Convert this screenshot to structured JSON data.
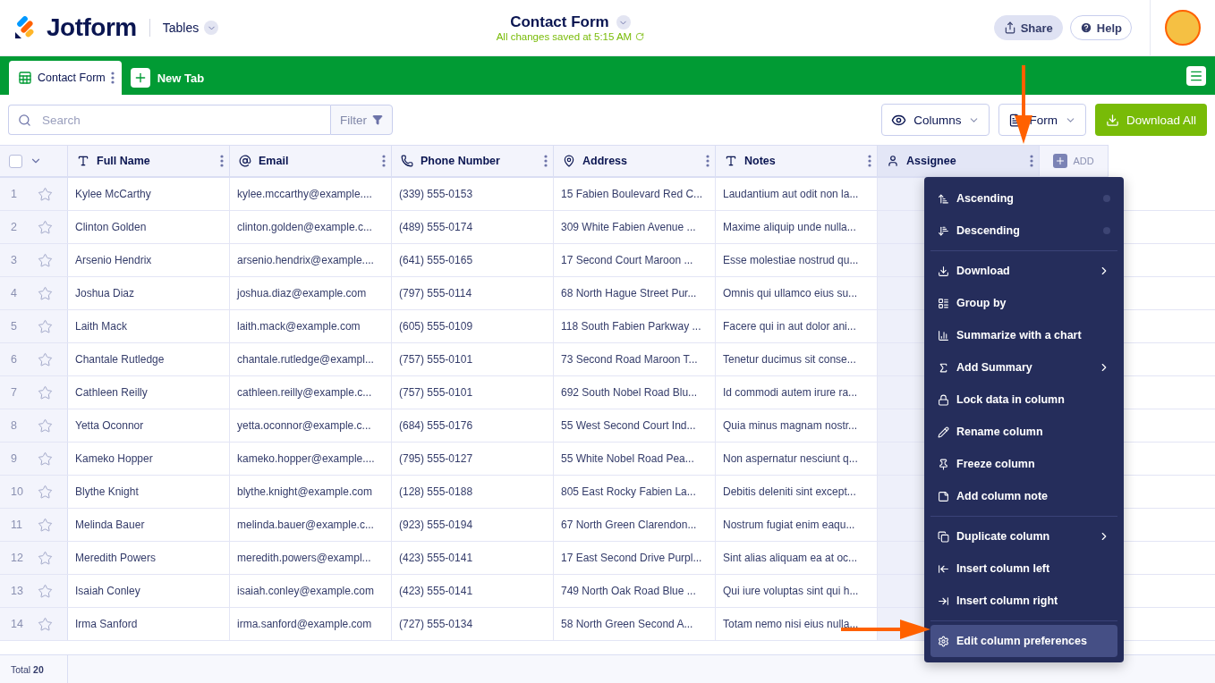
{
  "header": {
    "logo": "Jotform",
    "nav": "Tables",
    "title": "Contact Form",
    "save_status": "All changes saved at 5:15 AM",
    "share": "Share",
    "help": "Help"
  },
  "tabs": [
    {
      "label": "Contact Form",
      "selected": true
    }
  ],
  "new_tab": "New Tab",
  "toolbar": {
    "search_placeholder": "Search",
    "filter": "Filter",
    "columns": "Columns",
    "form": "Form",
    "download": "Download All"
  },
  "table": {
    "select_all": {
      "checked": false
    },
    "columns": [
      {
        "label": "Full Name",
        "kind": "text",
        "selected": false
      },
      {
        "label": "Email",
        "kind": "email",
        "selected": false
      },
      {
        "label": "Phone Number",
        "kind": "phone",
        "selected": false
      },
      {
        "label": "Address",
        "kind": "address",
        "selected": false
      },
      {
        "label": "Notes",
        "kind": "notes",
        "selected": false
      },
      {
        "label": "Assignee",
        "kind": "person",
        "selected": true
      }
    ],
    "add_column": "ADD",
    "rows": [
      {
        "number": "1",
        "starred": false,
        "cells": [
          "Kylee McCarthy",
          "kylee.mccarthy@example....",
          "(339) 555-0153",
          "15 Fabien Boulevard Red C...",
          "Laudantium aut odit non la...",
          ""
        ]
      },
      {
        "number": "2",
        "starred": false,
        "cells": [
          "Clinton Golden",
          "clinton.golden@example.c...",
          "(489) 555-0174",
          "309 White Fabien Avenue ...",
          "Maxime aliquip unde nulla...",
          ""
        ]
      },
      {
        "number": "3",
        "starred": false,
        "cells": [
          "Arsenio Hendrix",
          "arsenio.hendrix@example....",
          "(641) 555-0165",
          "17 Second Court Maroon ...",
          "Esse molestiae nostrud qu...",
          ""
        ]
      },
      {
        "number": "4",
        "starred": false,
        "cells": [
          "Joshua Diaz",
          "joshua.diaz@example.com",
          "(797) 555-0114",
          "68 North Hague Street Pur...",
          "Omnis qui ullamco eius su...",
          ""
        ]
      },
      {
        "number": "5",
        "starred": false,
        "cells": [
          "Laith Mack",
          "laith.mack@example.com",
          "(605) 555-0109",
          "118 South Fabien Parkway ...",
          "Facere qui in aut dolor ani...",
          ""
        ]
      },
      {
        "number": "6",
        "starred": false,
        "cells": [
          "Chantale Rutledge",
          "chantale.rutledge@exampl...",
          "(757) 555-0101",
          "73 Second Road Maroon T...",
          "Tenetur ducimus sit conse...",
          ""
        ]
      },
      {
        "number": "7",
        "starred": false,
        "cells": [
          "Cathleen Reilly",
          "cathleen.reilly@example.c...",
          "(757) 555-0101",
          "692 South Nobel Road Blu...",
          "Id commodi autem irure ra...",
          ""
        ]
      },
      {
        "number": "8",
        "starred": false,
        "cells": [
          "Yetta Oconnor",
          "yetta.oconnor@example.c...",
          "(684) 555-0176",
          "55 West Second Court Ind...",
          "Quia minus magnam nostr...",
          ""
        ]
      },
      {
        "number": "9",
        "starred": false,
        "cells": [
          "Kameko Hopper",
          "kameko.hopper@example....",
          "(795) 555-0127",
          "55 White Nobel Road Pea...",
          "Non aspernatur nesciunt q...",
          ""
        ]
      },
      {
        "number": "10",
        "starred": false,
        "cells": [
          "Blythe Knight",
          "blythe.knight@example.com",
          "(128) 555-0188",
          "805 East Rocky Fabien La...",
          "Debitis deleniti sint except...",
          ""
        ]
      },
      {
        "number": "11",
        "starred": false,
        "cells": [
          "Melinda Bauer",
          "melinda.bauer@example.c...",
          "(923) 555-0194",
          "67 North Green Clarendon...",
          "Nostrum fugiat enim eaqu...",
          ""
        ]
      },
      {
        "number": "12",
        "starred": false,
        "cells": [
          "Meredith Powers",
          "meredith.powers@exampl...",
          "(423) 555-0141",
          "17 East Second Drive Purpl...",
          "Sint alias aliquam ea at oc...",
          ""
        ]
      },
      {
        "number": "13",
        "starred": false,
        "cells": [
          "Isaiah Conley",
          "isaiah.conley@example.com",
          "(423) 555-0141",
          "749 North Oak Road Blue ...",
          "Qui iure voluptas sint qui h...",
          ""
        ]
      },
      {
        "number": "14",
        "starred": false,
        "cells": [
          "Irma Sanford",
          "irma.sanford@example.com",
          "(727) 555-0134",
          "58 North Green Second A...",
          "Totam nemo nisi eius nulla...",
          ""
        ]
      }
    ]
  },
  "footer": {
    "total": "Total **20**"
  },
  "menu": {
    "groups": [
      [
        {
          "label": "Ascending",
          "kind": "radio",
          "selected": false
        },
        {
          "label": "Descending",
          "kind": "radio",
          "selected": false
        }
      ],
      [
        {
          "label": "Download",
          "kind": "submenu",
          "selected": false
        },
        {
          "label": "Group by",
          "kind": "plain",
          "selected": false
        },
        {
          "label": "Summarize with a chart",
          "kind": "plain",
          "selected": false
        },
        {
          "label": "Add Summary",
          "kind": "submenu",
          "selected": false
        },
        {
          "label": "Lock data in column",
          "kind": "plain",
          "selected": false
        },
        {
          "label": "Rename column",
          "kind": "plain",
          "selected": false
        },
        {
          "label": "Freeze column",
          "kind": "plain",
          "selected": false
        },
        {
          "label": "Add column note",
          "kind": "plain",
          "selected": false
        }
      ],
      [
        {
          "label": "Duplicate column",
          "kind": "submenu",
          "selected": false
        },
        {
          "label": "Insert column left",
          "kind": "plain",
          "selected": false
        },
        {
          "label": "Insert column right",
          "kind": "plain",
          "selected": false
        }
      ],
      [
        {
          "label": "Edit column preferences",
          "kind": "plain",
          "selected": true
        }
      ]
    ]
  }
}
